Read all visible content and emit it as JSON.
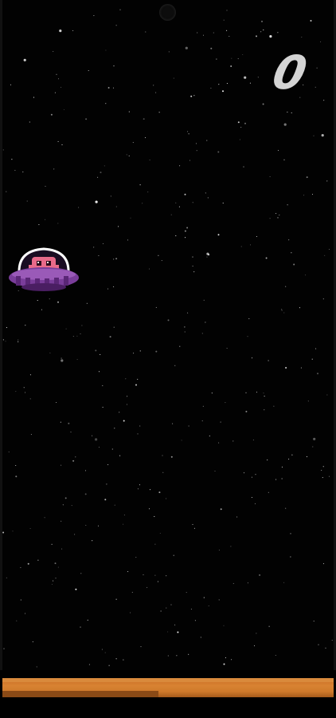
{
  "game": {
    "score": "0",
    "player_icon": "ufo-alien-icon",
    "background": "starfield",
    "colors": {
      "space": "#020202",
      "score_text": "#d4d4d4",
      "ground": "#d88232",
      "ufo_body": "#7a3d9a",
      "alien": "#e86a8a"
    }
  }
}
